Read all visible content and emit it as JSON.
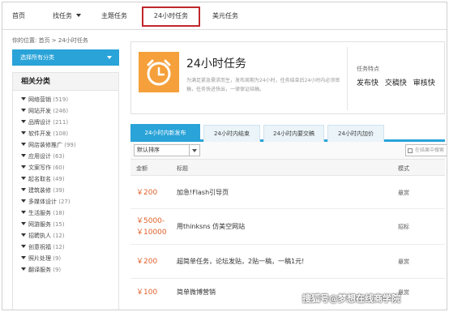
{
  "nav": {
    "items": [
      "首页",
      "找任务",
      "主题任务",
      "24小时任务",
      "美元任务"
    ]
  },
  "breadcrumb": "你的位置: 首页 > 24小时任务",
  "sidebar": {
    "select_label": "选择所有分类",
    "title": "相关分类",
    "categories": [
      {
        "label": "网络营销",
        "count": "(519)"
      },
      {
        "label": "网站开发",
        "count": "(246)"
      },
      {
        "label": "品牌设计",
        "count": "(211)"
      },
      {
        "label": "软件开发",
        "count": "(108)"
      },
      {
        "label": "网店装修推广",
        "count": "(99)"
      },
      {
        "label": "应用设计",
        "count": "(63)"
      },
      {
        "label": "文案写作",
        "count": "(60)"
      },
      {
        "label": "起名取名",
        "count": "(49)"
      },
      {
        "label": "建筑装修",
        "count": "(39)"
      },
      {
        "label": "多媒体设计",
        "count": "(27)"
      },
      {
        "label": "生活服务",
        "count": "(18)"
      },
      {
        "label": "网游服务",
        "count": "(15)"
      },
      {
        "label": "招聘执人",
        "count": "(12)"
      },
      {
        "label": "创意祝福",
        "count": "(12)"
      },
      {
        "label": "照片处理",
        "count": "(9)"
      },
      {
        "label": "翻译服务",
        "count": "(9)"
      }
    ]
  },
  "hero": {
    "icon": "alarm-clock-icon",
    "title": "24小时任务",
    "desc": "为满足紧急需求而生，发布周期为24小时，任务结束后24小时内必须审稿，任务快进快出，一律保证结稿。",
    "features_label": "任务特点",
    "features": [
      "发布快",
      "交稿快",
      "审核快"
    ]
  },
  "tabs": [
    "24小时内新发布",
    "24小时内结束",
    "24小时内要交稿",
    "24小时内加价"
  ],
  "filter": {
    "sort_label": "默认排序",
    "search_placeholder": "在结果中搜索"
  },
  "table": {
    "headers": {
      "amount": "金额",
      "title": "标题",
      "mode": "模式"
    },
    "rows": [
      {
        "amount": "￥200",
        "title": "加急!Flash引导页",
        "mode": "悬赏"
      },
      {
        "amount": "￥5000-\n￥10000",
        "title": "用thinksns 仿美空网站",
        "mode": "招标"
      },
      {
        "amount": "￥200",
        "title": "超简单任务，论坛发贴，2贴一稿，一稿1元!",
        "mode": "悬赏"
      },
      {
        "amount": "￥100",
        "title": "简单微博营销",
        "mode": "悬赏"
      }
    ]
  },
  "watermark": "搜狐号@梦想在线商学院",
  "colors": {
    "accent": "#29a3d8",
    "hero_icon": "#f5a03b",
    "price": "#e0602a",
    "active_nav_border": "#c0272d"
  }
}
